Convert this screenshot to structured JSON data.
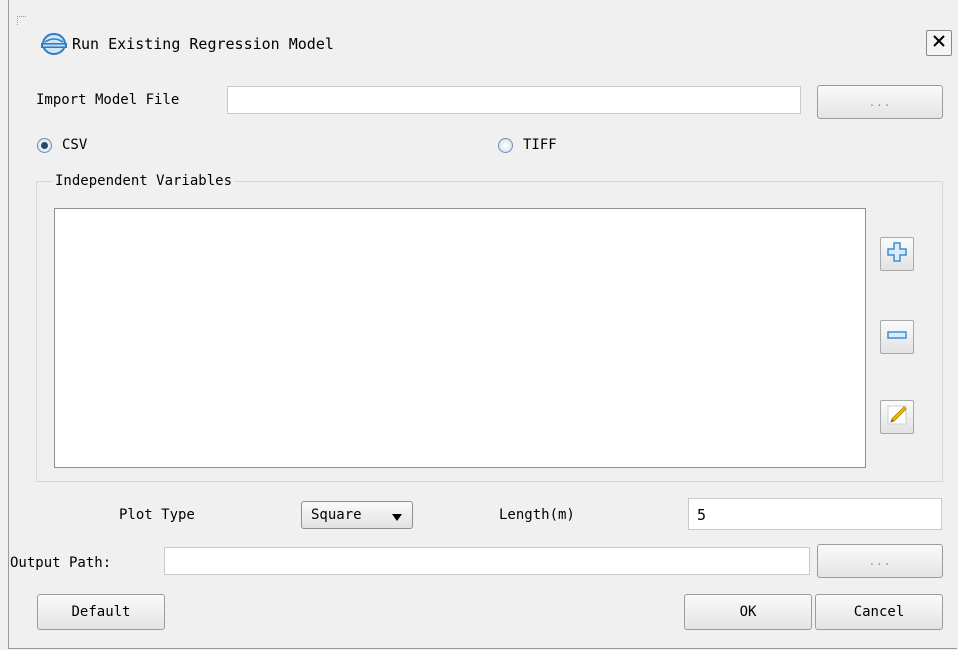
{
  "dialog": {
    "title": "Run Existing Regression Model",
    "close_label": "×"
  },
  "import_model": {
    "label": "Import Model File",
    "value": "",
    "browse_label": "..."
  },
  "data_format": {
    "options": [
      {
        "label": "CSV",
        "selected": true
      },
      {
        "label": "TIFF",
        "selected": false
      }
    ]
  },
  "independent_variables": {
    "group_title": "Independent Variables",
    "items": [],
    "buttons": {
      "add": "add-icon",
      "remove": "remove-icon",
      "edit": "edit-pencil-icon"
    }
  },
  "plot": {
    "type_label": "Plot Type",
    "type_value": "Square",
    "length_label": "Length(m)",
    "length_value": "5"
  },
  "output": {
    "label": "Output Path:",
    "value": "",
    "browse_label": "..."
  },
  "footer": {
    "default_label": "Default",
    "ok_label": "OK",
    "cancel_label": "Cancel"
  },
  "colors": {
    "window_bg": "#f0f0f0",
    "add_icon": "#3a8fd6",
    "remove_icon": "#3a8fd6",
    "pencil": "#e3b400"
  }
}
